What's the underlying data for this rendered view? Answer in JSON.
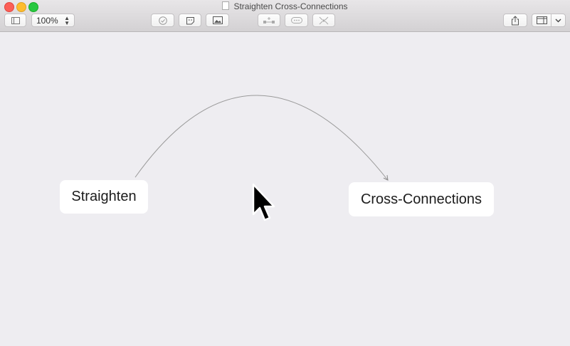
{
  "window": {
    "title": "Straighten Cross-Connections"
  },
  "toolbar": {
    "zoom_value": "100%",
    "icons": [
      "sidebar-icon",
      "checkmark-icon",
      "sticker-icon",
      "image-icon",
      "add-child-icon",
      "connect-icon",
      "reorganize-icon",
      "share-icon",
      "inspector-icon",
      "chevron-down-icon"
    ]
  },
  "canvas": {
    "nodes": [
      {
        "label": "Straighten"
      },
      {
        "label": "Cross-Connections"
      }
    ],
    "connection": {
      "from": "Straighten",
      "to": "Cross-Connections",
      "color": "#9a9a9a"
    }
  },
  "colors": {
    "close": "#fc5f57",
    "minimize": "#fdbc2e",
    "maximize": "#28c840"
  }
}
